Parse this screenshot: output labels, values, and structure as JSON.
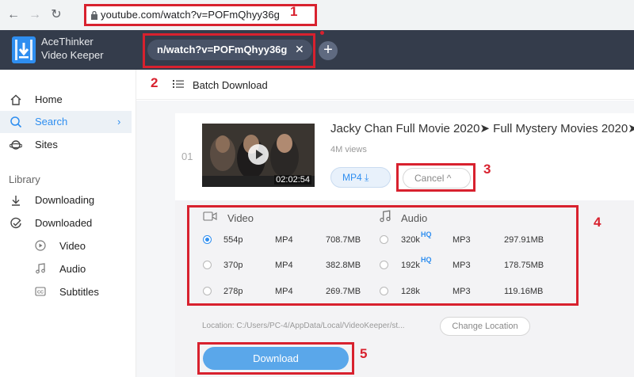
{
  "browser": {
    "url": "youtube.com/watch?v=POFmQhyy36g",
    "back_icon": "arrow-left-icon",
    "forward_icon": "arrow-right-icon",
    "reload_icon": "reload-icon"
  },
  "annotations": [
    "1",
    "2",
    "3",
    "4",
    "5"
  ],
  "app": {
    "brand_line1": "AceThinker",
    "brand_line2": "Video Keeper",
    "tab_label": "n/watch?v=POFmQhyy36g",
    "tab_close": "✕",
    "add_tab": "+"
  },
  "sidebar": {
    "items": [
      {
        "label": "Home",
        "icon": "home-icon"
      },
      {
        "label": "Search",
        "icon": "search-icon",
        "active": true,
        "chevron": "›"
      },
      {
        "label": "Sites",
        "icon": "planet-icon"
      }
    ],
    "library_label": "Library",
    "library_items": [
      {
        "label": "Downloading",
        "icon": "download-arrow-icon"
      },
      {
        "label": "Downloaded",
        "icon": "check-circle-icon"
      }
    ],
    "sub_items": [
      {
        "label": "Video",
        "icon": "play-circle-icon"
      },
      {
        "label": "Audio",
        "icon": "music-note-icon"
      },
      {
        "label": "Subtitles",
        "icon": "cc-icon"
      }
    ]
  },
  "main": {
    "batch_label": "Batch Download",
    "video": {
      "index": "01",
      "title": "Jacky Chan Full Movie 2020➤ Full Mystery Movies 2020➤",
      "views": "4M views",
      "duration": "02:02:54",
      "format_button": "MP4 ⤓",
      "cancel_button": "Cancel ^"
    },
    "options": {
      "video_header": "Video",
      "audio_header": "Audio",
      "hq_label": "HQ",
      "video_rows": [
        {
          "quality": "554p",
          "format": "MP4",
          "size": "708.7MB",
          "selected": true
        },
        {
          "quality": "370p",
          "format": "MP4",
          "size": "382.8MB",
          "selected": false
        },
        {
          "quality": "278p",
          "format": "MP4",
          "size": "269.7MB",
          "selected": false
        }
      ],
      "audio_rows": [
        {
          "quality": "320k",
          "hq": true,
          "format": "MP3",
          "size": "297.91MB"
        },
        {
          "quality": "192k",
          "hq": true,
          "format": "MP3",
          "size": "178.75MB"
        },
        {
          "quality": "128k",
          "hq": false,
          "format": "MP3",
          "size": "119.16MB"
        }
      ]
    },
    "location": "Location: C:/Users/PC-4/AppData/Local/VideoKeeper/st...",
    "change_location": "Change Location",
    "download_button": "Download"
  },
  "colors": {
    "accent": "#2e8ef0",
    "highlight": "#d8212e",
    "header_bg": "#343c4b"
  }
}
